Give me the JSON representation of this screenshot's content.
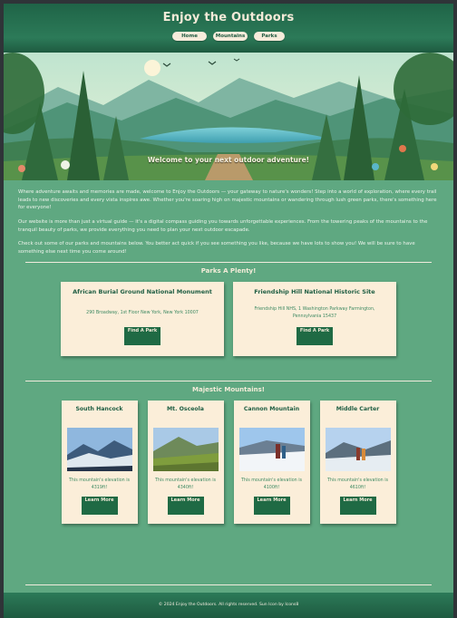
{
  "header": {
    "title": "Enjoy the Outdoors",
    "nav": [
      "Home",
      "Mountains",
      "Parks"
    ]
  },
  "hero": {
    "caption": "Welcome to your next outdoor adventure!"
  },
  "intro": {
    "paragraphs": [
      "Where adventure awaits and memories are made, welcome to Enjoy the Outdoors — your gateway to nature's wonders! Step into a world of exploration, where every trail leads to new discoveries and every vista inspires awe. Whether you're soaring high on majestic mountains or wandering through lush green parks, there's something here for everyone!",
      "Our website is more than just a virtual guide — it's a digital compass guiding you towards unforgettable experiences. From the towering peaks of the mountains to the tranquil beauty of parks, we provide everything you need to plan your next outdoor escapade.",
      "Check out some of our parks and mountains below. You better act quick if you see something you like, because we have lots to show you! We will be sure to have something else next time you come around!"
    ]
  },
  "parks": {
    "title": "Parks A Plenty!",
    "items": [
      {
        "name": "African Burial Ground National Monument",
        "address": "290 Broadway, 1st Floor New York, New York 10007",
        "button": "Find A Park"
      },
      {
        "name": "Friendship Hill National Historic Site",
        "address": "Friendship Hill NHS, 1 Washington Parkway Farmington, Pennsylvania 15437",
        "button": "Find A Park"
      }
    ]
  },
  "mountains": {
    "title": "Majestic Mountains!",
    "items": [
      {
        "name": "South Hancock",
        "elevation": "This mountain's elevation is 4319ft!",
        "button": "Learn More"
      },
      {
        "name": "Mt. Osceola",
        "elevation": "This mountain's elevation is 4340ft!",
        "button": "Learn More"
      },
      {
        "name": "Cannon Mountain",
        "elevation": "This mountain's elevation is 4100ft!",
        "button": "Learn More"
      },
      {
        "name": "Middle Carter",
        "elevation": "This mountain's elevation is 4610ft!",
        "button": "Learn More"
      }
    ]
  },
  "footer": {
    "text": "© 2024 Enjoy the Outdoors. All rights reserved. Sun Icon by Icons8"
  },
  "colors": {
    "background": "#5fa881",
    "header": "#1f6447",
    "card": "#fbeed9",
    "button": "#1f6a44",
    "accent_text": "#1f5e43"
  }
}
